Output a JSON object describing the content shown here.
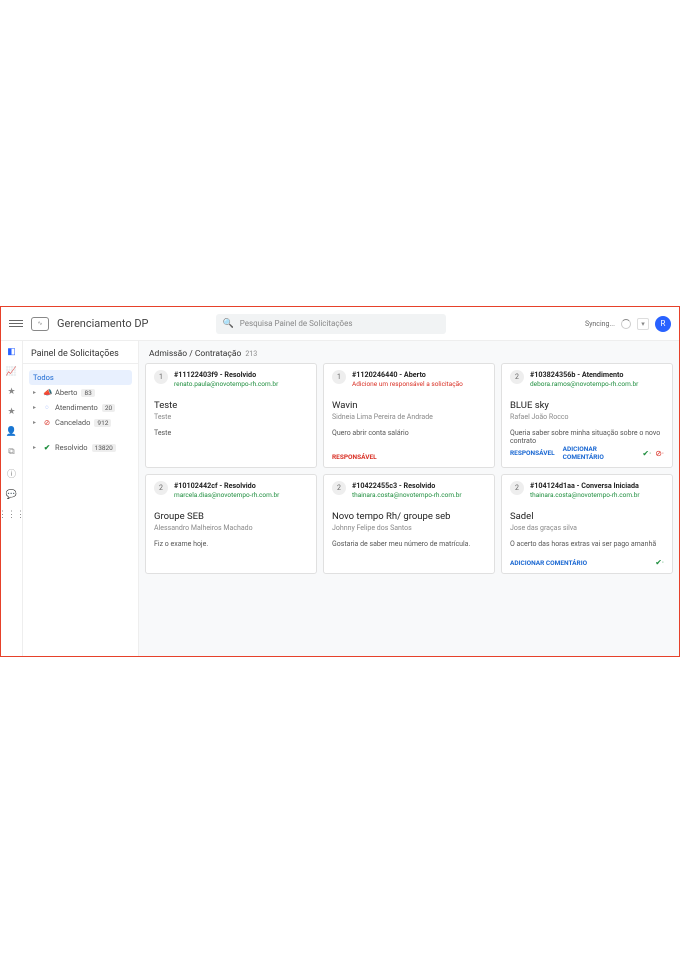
{
  "header": {
    "app_title": "Gerenciamento DP",
    "search_placeholder": "Pesquisa Painel de Solicitações",
    "syncing_label": "Syncing...",
    "avatar_initial": "R"
  },
  "sidepanel": {
    "title": "Painel de Solicitações",
    "filters": {
      "todos": "Todos",
      "aberto": {
        "label": "Aberto",
        "count": "83"
      },
      "atendimento": {
        "label": "Atendimento",
        "count": "20"
      },
      "cancelado": {
        "label": "Cancelado",
        "count": "912"
      },
      "resolvido": {
        "label": "Resolvido",
        "count": "13820"
      }
    }
  },
  "section": {
    "title": "Admissão / Contratação",
    "count": "213"
  },
  "cards": [
    {
      "prio": "1",
      "id": "#11122403f9 - Resolvido",
      "sub": "renato.paula@novotempo-rh.com.br",
      "sub_class": "",
      "title": "Teste",
      "person": "Teste",
      "body": "Teste",
      "footer_type": "none"
    },
    {
      "prio": "1",
      "id": "#1120246440 - Aberto",
      "sub": "Adicione um responsável a solicitação",
      "sub_class": "red",
      "title": "Wavin",
      "person": "Sidneia Lima Pereira de Andrade",
      "body": "Quero abrir conta salário",
      "footer_type": "resp"
    },
    {
      "prio": "2",
      "id": "#103824356b - Atendimento",
      "sub": "debora.ramos@novotempo-rh.com.br",
      "sub_class": "",
      "title": "BLUE sky",
      "person": "Rafael João Rocco",
      "body": "Queria saber sobre minha situação sobre o novo contrato",
      "footer_type": "resp_add_icons"
    },
    {
      "prio": "2",
      "id": "#10102442cf - Resolvido",
      "sub": "marcela.dias@novotempo-rh.com.br",
      "sub_class": "",
      "title": "Groupe SEB",
      "person": "Alessandro Malheiros Machado",
      "body": "Fiz o exame hoje.",
      "footer_type": "none"
    },
    {
      "prio": "2",
      "id": "#10422455c3 - Resolvido",
      "sub": "thainara.costa@novotempo-rh.com.br",
      "sub_class": "",
      "title": "Novo tempo Rh/ groupe seb",
      "person": "Johnny Felipe dos Santos",
      "body": "Gostaria de saber meu número de matrícula.",
      "footer_type": "none"
    },
    {
      "prio": "2",
      "id": "#104124d1aa - Conversa Iniciada",
      "sub": "thainara.costa@novotempo-rh.com.br",
      "sub_class": "",
      "title": "Sadel",
      "person": "Jose das graças silva",
      "body": "O acerto das horas extras vai ser pago amanhã",
      "footer_type": "add_icon"
    }
  ],
  "actions": {
    "responsavel": "RESPONSÁVEL",
    "adicionar_comentario": "ADICIONAR COMENTÁRIO"
  }
}
